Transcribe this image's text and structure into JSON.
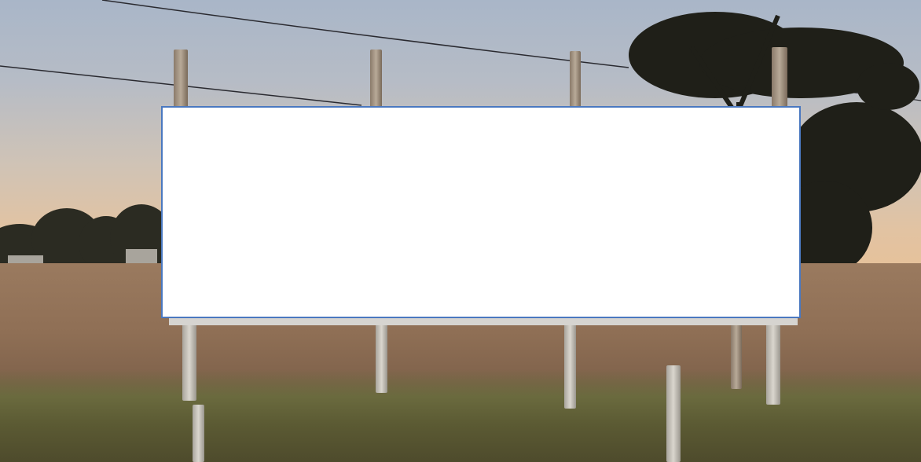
{
  "scene": {
    "description_type": "photograph",
    "colors": {
      "sky_top": "#a9b6c8",
      "sky_horizon": "#e6c19a",
      "field": "#8f6f55",
      "grass": "#5b5a33",
      "board": "#ffffff",
      "board_border": "#4a78c0"
    }
  },
  "billboard": {
    "text": ""
  }
}
